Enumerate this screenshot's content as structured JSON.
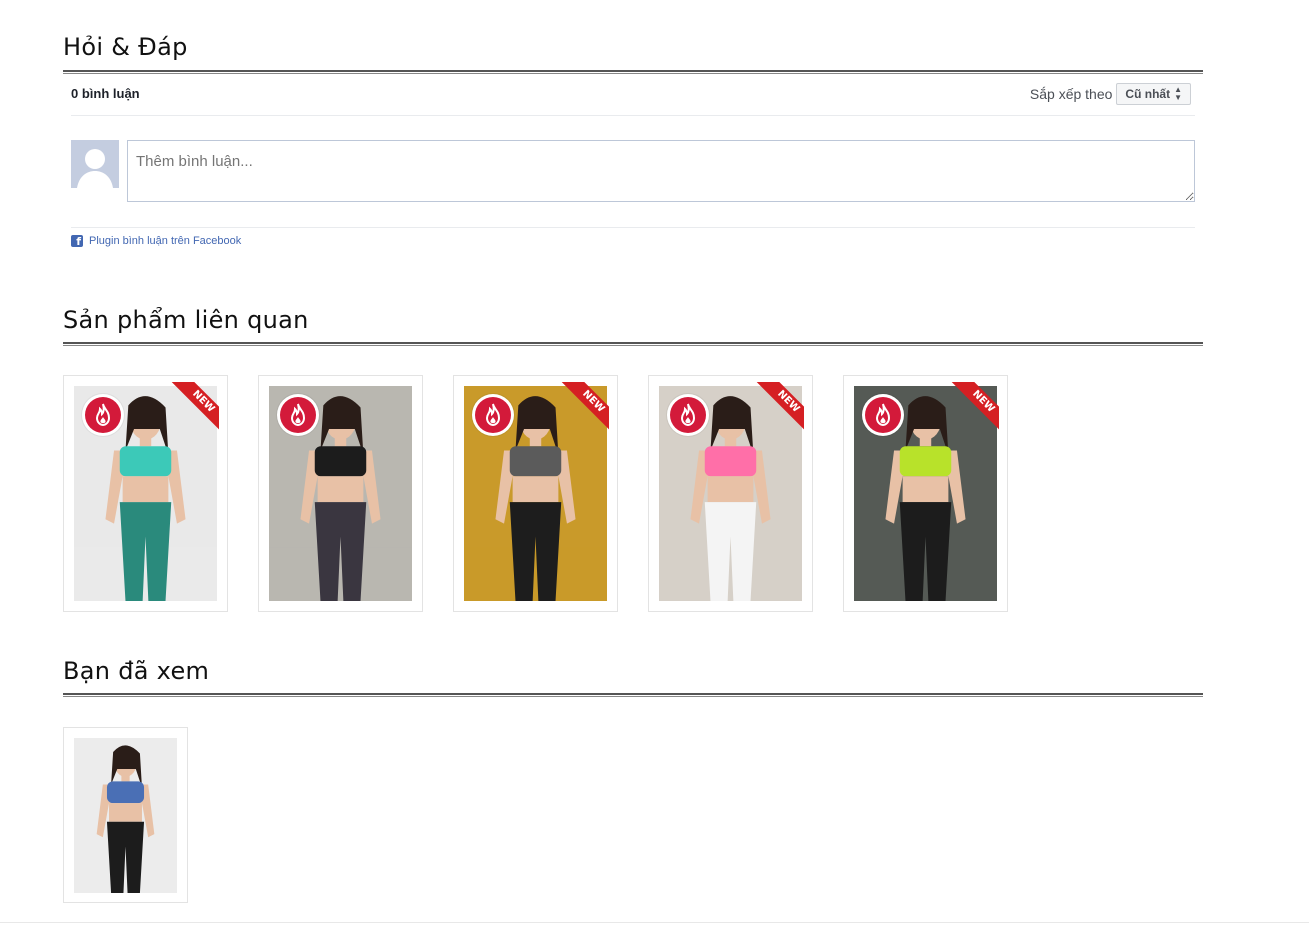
{
  "qa": {
    "title": "Hỏi & Đáp",
    "comment_count": "0 bình luận",
    "sort_label": "Sắp xếp theo",
    "sort_value": "Cũ nhất",
    "input_placeholder": "Thêm bình luận...",
    "plugin_label": "Plugin bình luận trên Facebook"
  },
  "related": {
    "title": "Sản phẩm liên quan",
    "items": [
      {
        "badge": "NEW",
        "icon": "fire-icon",
        "top_color": "#3cc9b8",
        "bottom_color": "#2a8a7c",
        "bg": "#e9e9e9"
      },
      {
        "badge": "",
        "icon": "fire-icon",
        "top_color": "#1c1c1c",
        "bottom_color": "#3a3640",
        "bg": "#b9b7b0"
      },
      {
        "badge": "NEW",
        "icon": "fire-icon",
        "top_color": "#5b5b5b",
        "bottom_color": "#1d1d1d",
        "bg": "#c99a2a"
      },
      {
        "badge": "NEW",
        "icon": "fire-icon",
        "top_color": "#ff6fa8",
        "bottom_color": "#f4f4f4",
        "bg": "#d6d0c8"
      },
      {
        "badge": "NEW",
        "icon": "fire-icon",
        "top_color": "#b8e22a",
        "bottom_color": "#1c1c1c",
        "bg": "#555a55"
      }
    ]
  },
  "viewed": {
    "title": "Bạn đã xem",
    "items": [
      {
        "top_color": "#4a6fb5",
        "bottom_color": "#1c1c1c",
        "bg": "#ececec"
      }
    ]
  }
}
